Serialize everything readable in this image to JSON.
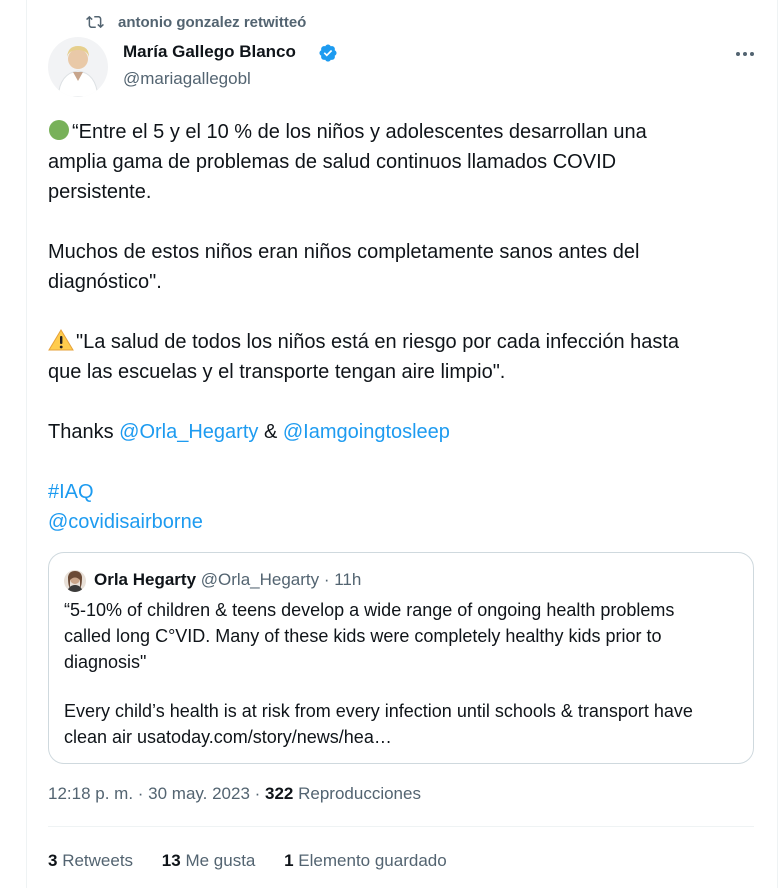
{
  "retweet": {
    "label": "antonio gonzalez retwitteó"
  },
  "author": {
    "name": "María Gallego Blanco",
    "handle": "@mariagallegobl"
  },
  "tweet": {
    "line1": "“Entre el 5 y el 10 % de los niños y adolescentes desarrollan una",
    "line2": "amplia gama de problemas de salud continuos llamados COVID",
    "line3": "persistente.",
    "line4": "Muchos de estos niños eran niños completamente sanos antes del",
    "line5": "diagnóstico\".",
    "line6": "\"La salud de todos los niños está en riesgo por cada infección hasta",
    "line7": "que las escuelas y el transporte tengan aire limpio\".",
    "thanks": "Thanks ",
    "mention1": "@Orla_Hegarty",
    "amp": " & ",
    "mention2": "@Iamgoingtosleep",
    "hashtag": "#IAQ",
    "mention3": "@covidisairborne"
  },
  "quote": {
    "name": "Orla Hegarty",
    "meta": " @Orla_Hegarty · 11h",
    "line1": "“5-10% of children & teens develop a wide range of ongoing health problems",
    "line2": "called long C°VID. Many of these kids were completely healthy kids prior to",
    "line3": "diagnosis\"",
    "line4": "Every child’s health is at risk from every infection until schools & transport have",
    "line5": "clean air usatoday.com/story/news/hea…"
  },
  "meta": {
    "time": "12:18 p. m. · 30 may. 2023 · ",
    "views_count": "322",
    "views_label": " Reproducciones"
  },
  "stats": {
    "retweets_count": "3",
    "retweets_label": " Retweets",
    "likes_count": "13",
    "likes_label": " Me gusta",
    "saved_count": "1",
    "saved_label": " Elemento guardado"
  },
  "colors": {
    "accent": "#1d9bf0",
    "text": "#0f1419",
    "muted": "#536471",
    "border": "#cfd9de",
    "verified": "#1d9bf0"
  },
  "icons": {
    "retweet": "retweet-icon",
    "verified": "verified-badge-icon",
    "more": "more-icon",
    "green": "green-circle-emoji",
    "warning": "warning-emoji"
  }
}
